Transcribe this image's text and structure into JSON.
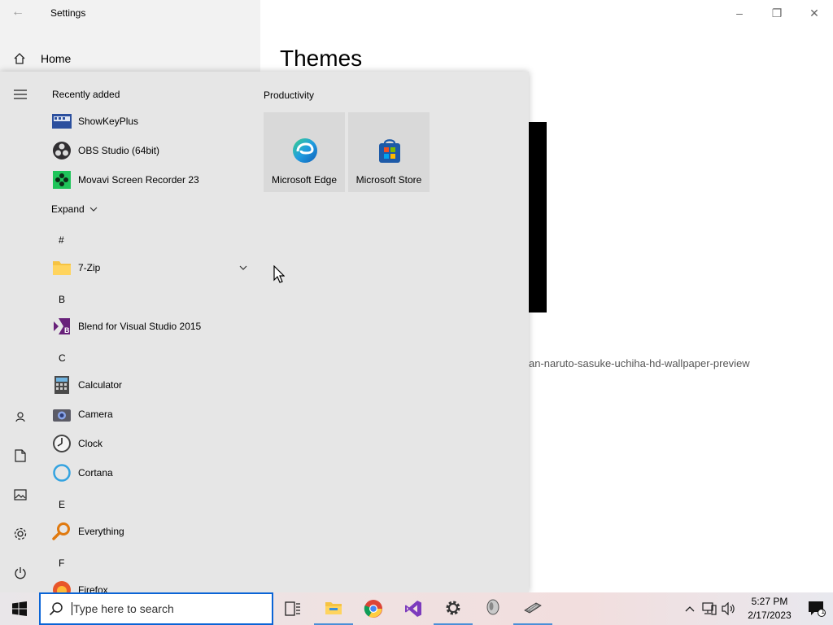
{
  "settings_window": {
    "title": "Settings",
    "home_label": "Home",
    "page_title": "Themes",
    "wallpaper_name": "an-naruto-sasuke-uchiha-hd-wallpaper-preview"
  },
  "start_menu": {
    "recently_added_label": "Recently added",
    "recent_apps": [
      {
        "label": "ShowKeyPlus",
        "icon": "showkeyplus-icon"
      },
      {
        "label": "OBS Studio (64bit)",
        "icon": "obs-icon"
      },
      {
        "label": "Movavi Screen Recorder 23",
        "icon": "movavi-icon"
      }
    ],
    "expand_label": "Expand",
    "letters": {
      "hash": "#",
      "b": "B",
      "c": "C",
      "e": "E",
      "f": "F"
    },
    "apps": {
      "zip": "7-Zip",
      "blend": "Blend for Visual Studio 2015",
      "calculator": "Calculator",
      "camera": "Camera",
      "clock": "Clock",
      "cortana": "Cortana",
      "everything": "Everything",
      "firefox": "Firefox"
    },
    "tile_group_title": "Productivity",
    "tiles": [
      {
        "label": "Microsoft Edge",
        "icon": "edge-icon"
      },
      {
        "label": "Microsoft Store",
        "icon": "store-icon"
      }
    ]
  },
  "taskbar": {
    "search_placeholder": "Type here to search",
    "time": "5:27 PM",
    "date": "2/17/2023",
    "notification_count": "1"
  },
  "colors": {
    "accent": "#0a64d6",
    "start_bg": "#e6e6e6",
    "settings_left_bg": "#f2f2f2"
  }
}
